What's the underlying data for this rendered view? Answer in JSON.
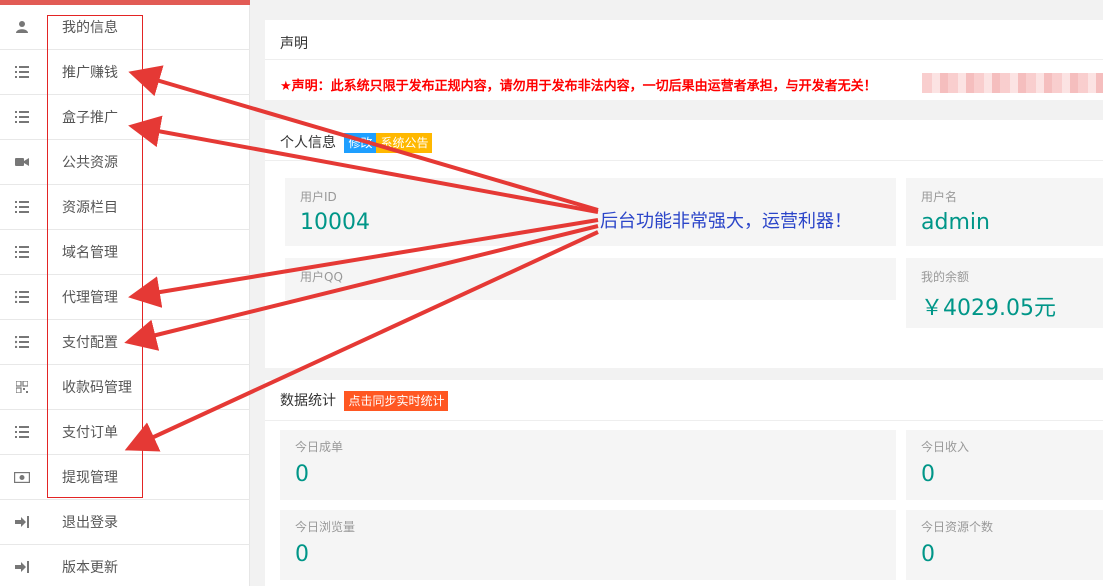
{
  "sidebar": {
    "items": [
      {
        "label": "我的信息",
        "icon": "user-icon"
      },
      {
        "label": "推广赚钱",
        "icon": "list-icon"
      },
      {
        "label": "盒子推广",
        "icon": "list-icon"
      },
      {
        "label": "公共资源",
        "icon": "video-camera-icon"
      },
      {
        "label": "资源栏目",
        "icon": "list-icon"
      },
      {
        "label": "域名管理",
        "icon": "list-icon"
      },
      {
        "label": "代理管理",
        "icon": "list-icon"
      },
      {
        "label": "支付配置",
        "icon": "list-icon"
      },
      {
        "label": "收款码管理",
        "icon": "qrcode-icon"
      },
      {
        "label": "支付订单",
        "icon": "list-icon"
      },
      {
        "label": "提现管理",
        "icon": "money-icon"
      },
      {
        "label": "退出登录",
        "icon": "sign-out-icon"
      },
      {
        "label": "版本更新",
        "icon": "sign-out-icon"
      }
    ]
  },
  "notice": {
    "title": "声明",
    "text": "★声明：此系统只限于发布正规内容，请勿用于发布非法内容，一切后果由运营者承担，与开发者无关！"
  },
  "profile": {
    "title": "个人信息",
    "edit_tag": "修改",
    "announce_tag": "系统公告",
    "user_id_label": "用户ID",
    "user_id": "10004",
    "username_label": "用户名",
    "username": "admin",
    "qq_label": "用户QQ",
    "qq": "",
    "balance_label": "我的余额",
    "balance": "￥4029.05元"
  },
  "stats": {
    "title": "数据统计",
    "sync_tag": "点击同步实时统计",
    "today_orders_label": "今日成单",
    "today_orders": "0",
    "today_income_label": "今日收入",
    "today_income": "0",
    "today_views_label": "今日浏览量",
    "today_views": "0",
    "today_resources_label": "今日资源个数",
    "today_resources": "0"
  },
  "annotation": {
    "text": "后台功能非常强大，运营利器！"
  },
  "colors": {
    "accent_teal": "#009688",
    "annotation_red": "#e53935",
    "annotation_blue": "#2b45c9"
  }
}
